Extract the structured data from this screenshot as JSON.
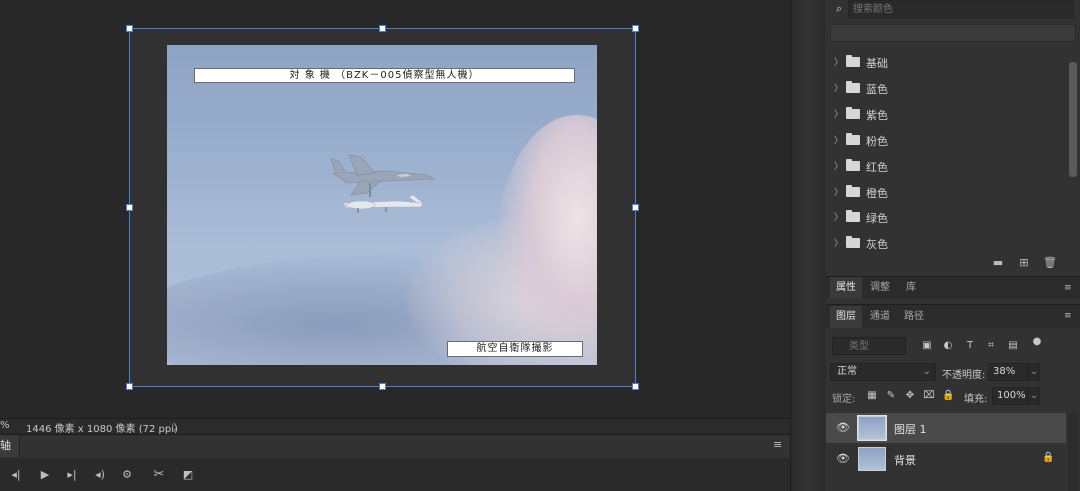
{
  "document": {
    "caption_top": "対 象 機 （BZK－005偵察型無人機）",
    "caption_bottom": "航空自衛隊撮影"
  },
  "status": {
    "zoom": "%",
    "doc_info": "1446 像素 x 1080 像素 (72 ppi)",
    "arrow": "〉"
  },
  "timeline": {
    "tab_label": "轴",
    "menu": "≡"
  },
  "swatches": {
    "search_placeholder": "搜索颜色",
    "folders": [
      "基础",
      "蓝色",
      "紫色",
      "粉色",
      "红色",
      "橙色",
      "绿色",
      "灰色"
    ]
  },
  "props_tabs": [
    "属性",
    "调整",
    "库"
  ],
  "layers_tabs": [
    "图层",
    "通道",
    "路径"
  ],
  "layers": {
    "filter_placeholder": "类型",
    "blend_mode": "正常",
    "opacity_label": "不透明度:",
    "opacity": "38%",
    "lock_label": "锁定:",
    "fill_label": "填充:",
    "fill": "100%",
    "items": [
      {
        "name": "图层 1",
        "selected": true
      },
      {
        "name": "背景",
        "selected": false,
        "locked": true
      }
    ]
  },
  "colors": {
    "selection": "#4a7fd1",
    "panel_bg": "#323232",
    "canvas_bg": "#282828"
  }
}
